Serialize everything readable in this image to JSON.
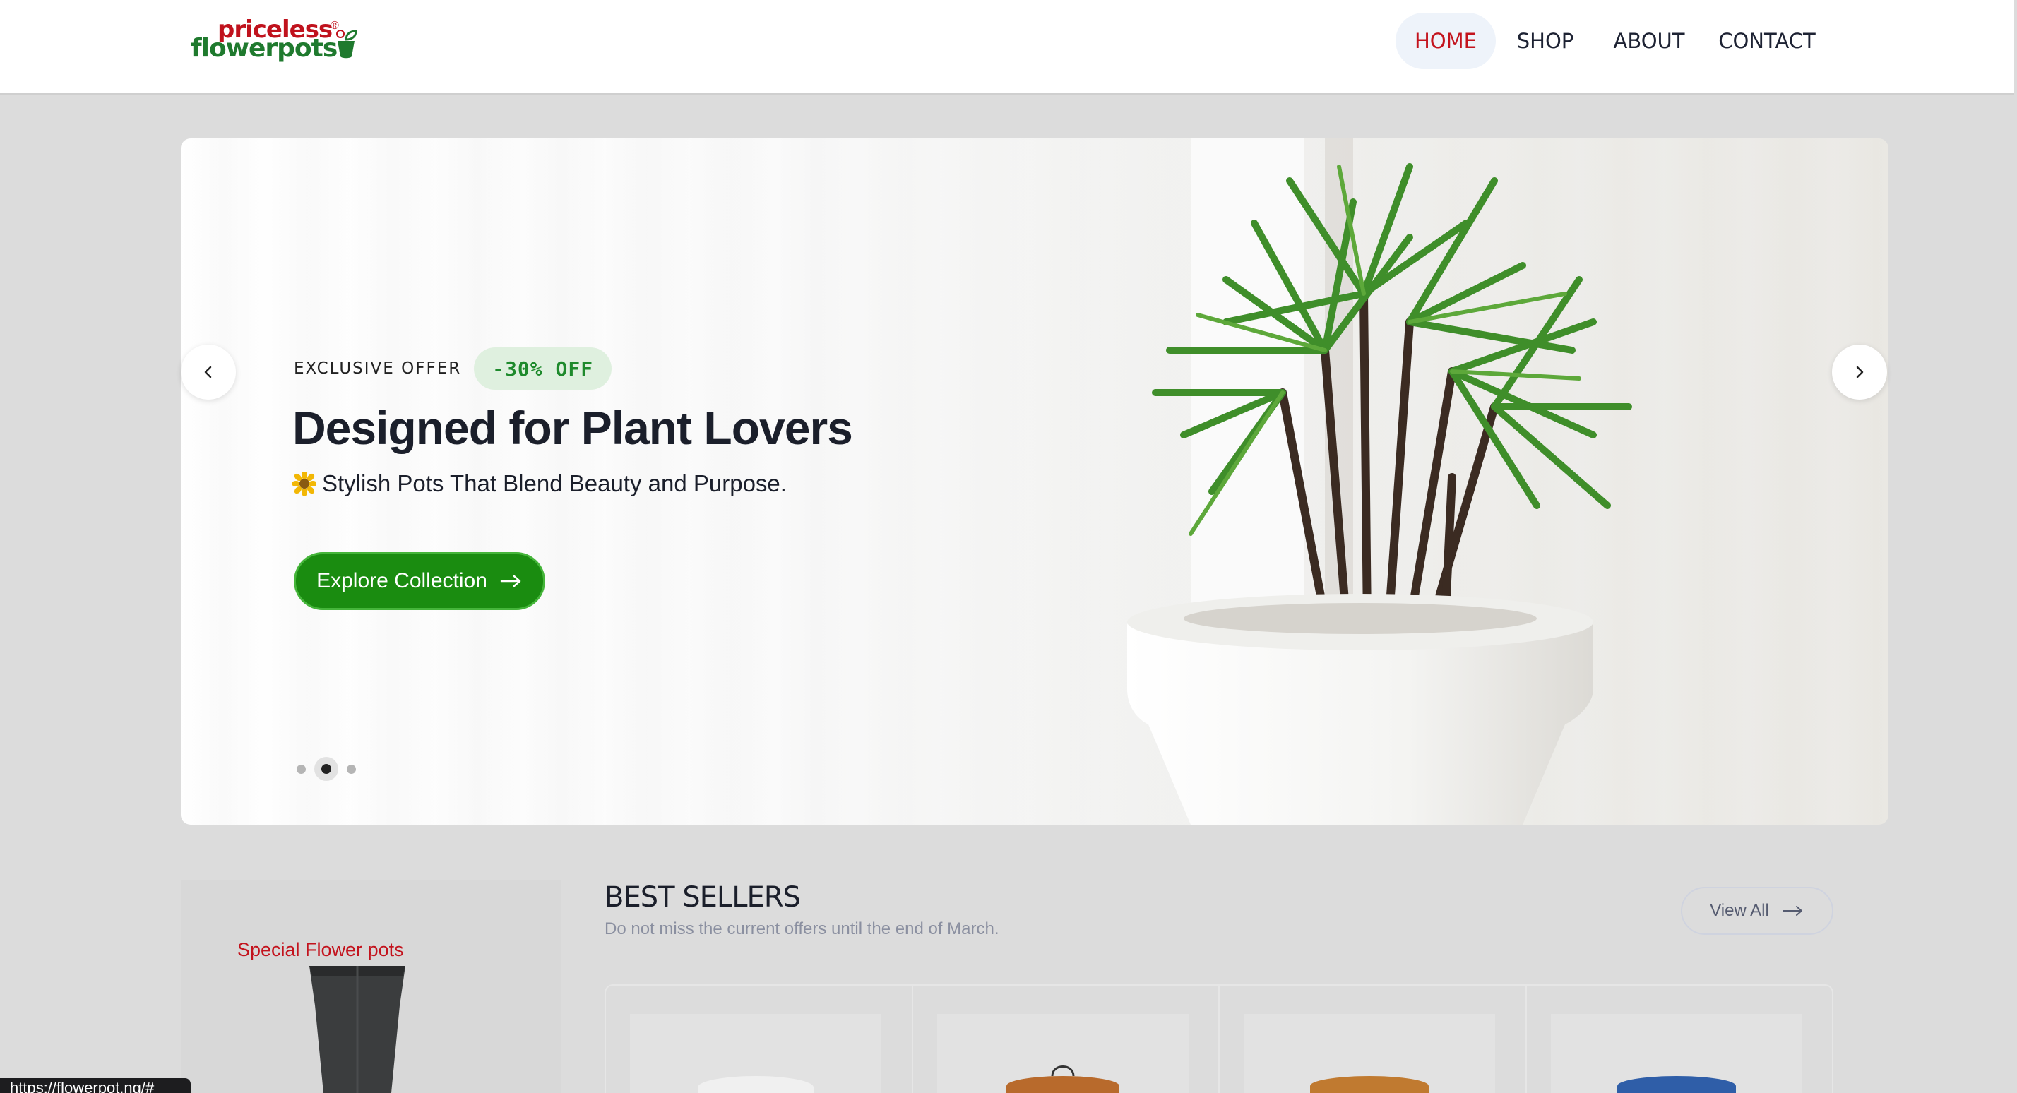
{
  "header": {
    "logo": {
      "line1": "priceless",
      "line2": "flowerpots",
      "reg": "®"
    },
    "nav": [
      {
        "label": "HOME",
        "active": true
      },
      {
        "label": "SHOP",
        "active": false
      },
      {
        "label": "ABOUT",
        "active": false
      },
      {
        "label": "CONTACT",
        "active": false
      }
    ]
  },
  "hero": {
    "offer_label": "EXCLUSIVE OFFER",
    "offer_badge": "-30% OFF",
    "title": "Designed for Plant Lovers",
    "subtitle": "Stylish Pots That Blend Beauty and Purpose.",
    "subtitle_icon": "sunflower-icon",
    "cta_label": "Explore Collection",
    "slides_total": 3,
    "active_slide": 2
  },
  "promo": {
    "label": "Special Flower pots"
  },
  "best_sellers": {
    "title": "BEST SELLERS",
    "subtitle": "Do not miss the current offers until the end of March.",
    "view_all": "View All",
    "products": [
      {
        "pot_color": "#e8e8e8"
      },
      {
        "pot_color": "#b86a2c"
      },
      {
        "pot_color": "#c07a30"
      },
      {
        "pot_color": "#2f5ea8"
      }
    ]
  },
  "status_bar": {
    "url": "https://flowerpot.ng/#"
  },
  "colors": {
    "brand_red": "#c3131d",
    "brand_green": "#1f7a2e",
    "cta_green": "#1a8c10"
  }
}
